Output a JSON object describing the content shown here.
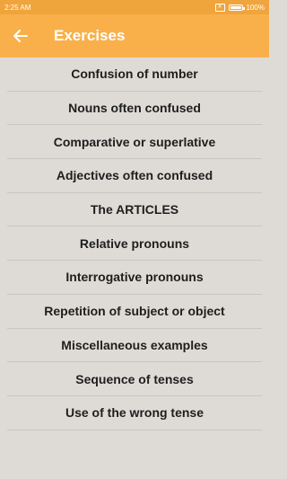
{
  "status_bar": {
    "time": "2:25 AM",
    "sim_icon": "sim-x-icon",
    "battery_percent": "100%"
  },
  "app_bar": {
    "back_icon": "arrow-left-icon",
    "title": "Exercises"
  },
  "exercises": [
    {
      "label": "Confusion of number"
    },
    {
      "label": "Nouns often confused"
    },
    {
      "label": "Comparative or superlative"
    },
    {
      "label": "Adjectives often confused"
    },
    {
      "label": "The ARTICLES"
    },
    {
      "label": "Relative pronouns"
    },
    {
      "label": "Interrogative pronouns"
    },
    {
      "label": "Repetition of subject or object"
    },
    {
      "label": "Miscellaneous examples"
    },
    {
      "label": "Sequence of tenses"
    },
    {
      "label": "Use of the wrong tense"
    }
  ],
  "colors": {
    "status_bar": "#f0a43c",
    "app_bar": "#f9b04a",
    "background": "#dedbd6",
    "divider": "#c9c6c1"
  }
}
